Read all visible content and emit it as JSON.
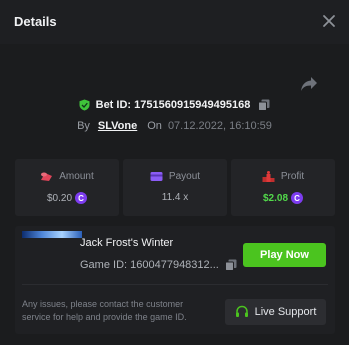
{
  "header": {
    "title": "Details"
  },
  "bet": {
    "id_text": "Bet ID: 1751560915949495168",
    "by_label": "By",
    "user": "SLVone",
    "on_label": "On",
    "date": "07.12.2022, 16:10:59"
  },
  "stats": {
    "amount": {
      "label": "Amount",
      "value": "$0.20"
    },
    "payout": {
      "label": "Payout",
      "value": "11.4 x"
    },
    "profit": {
      "label": "Profit",
      "value": "$2.08"
    }
  },
  "coin_symbol": "C",
  "game": {
    "name": "Jack Frost's Winter",
    "id_text": "Game ID: 1600477948312...",
    "play_label": "Play Now"
  },
  "support": {
    "notice": "Any issues, please contact the customer service for help and provide the game ID.",
    "button_label": "Live Support"
  },
  "colors": {
    "accent_green": "#4bc41f",
    "profit_green": "#52d94b",
    "coin_purple": "#7d3cf0",
    "amount_icon": "#e0455a",
    "payout_icon": "#8b5cf6",
    "profit_icon": "#e03a3a"
  },
  "icons": {
    "close": "close-icon",
    "share": "share-icon",
    "shield": "shield-icon",
    "copy": "copy-icon",
    "amount": "coins-icon",
    "payout": "wallet-icon",
    "profit": "podium-icon",
    "support": "headset-icon"
  }
}
